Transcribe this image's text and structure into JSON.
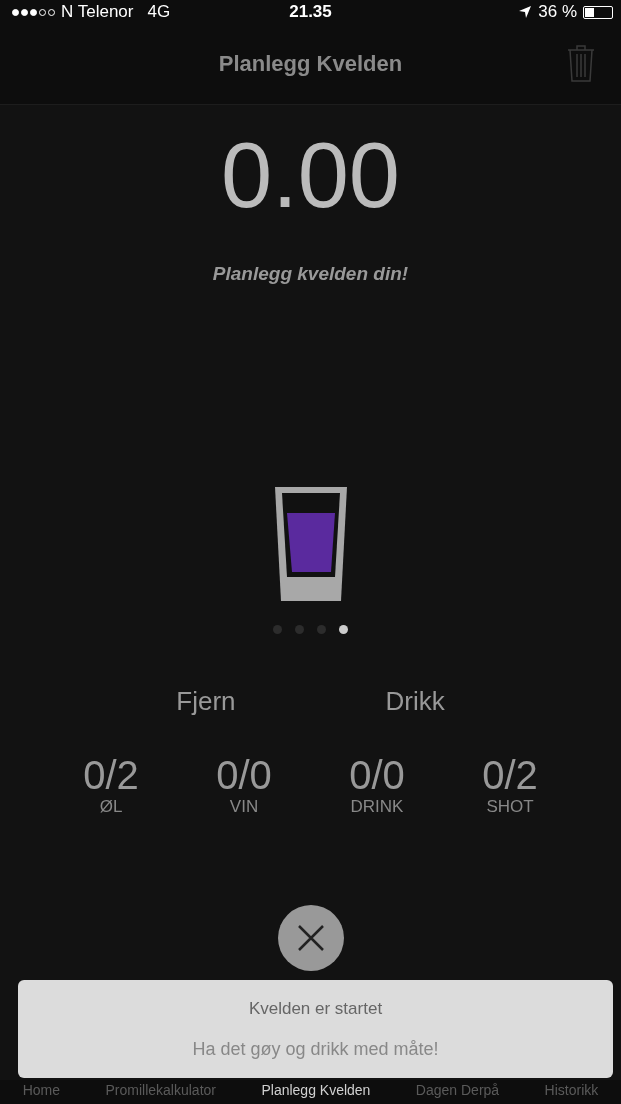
{
  "status_bar": {
    "carrier": "N Telenor",
    "network": "4G",
    "time": "21.35",
    "battery_text": "36 %",
    "battery": {
      "level": 0.36
    }
  },
  "nav": {
    "title": "Planlegg Kvelden"
  },
  "bac": "0.00",
  "subtitle": "Planlegg kvelden din!",
  "pages": [
    {
      "selected": false
    },
    {
      "selected": false
    },
    {
      "selected": false
    },
    {
      "selected": true
    }
  ],
  "actions": [
    "Fjern",
    "Drikk"
  ],
  "counters": [
    {
      "value": "0/2",
      "label": "ØL"
    },
    {
      "value": "0/0",
      "label": "VIN"
    },
    {
      "value": "0/0",
      "label": "DRINK"
    },
    {
      "value": "0/2",
      "label": "SHOT"
    }
  ],
  "toast": {
    "title": "Kvelden er startet",
    "message": "Ha det gøy og drikk med måte!"
  },
  "tabs": [
    {
      "label": "Home",
      "selected": false
    },
    {
      "label": "Promillekalkulator",
      "selected": false
    },
    {
      "label": "Planlegg Kvelden",
      "selected": true
    },
    {
      "label": "Dagen Derpå",
      "selected": false
    },
    {
      "label": "Historikk",
      "selected": false
    }
  ]
}
